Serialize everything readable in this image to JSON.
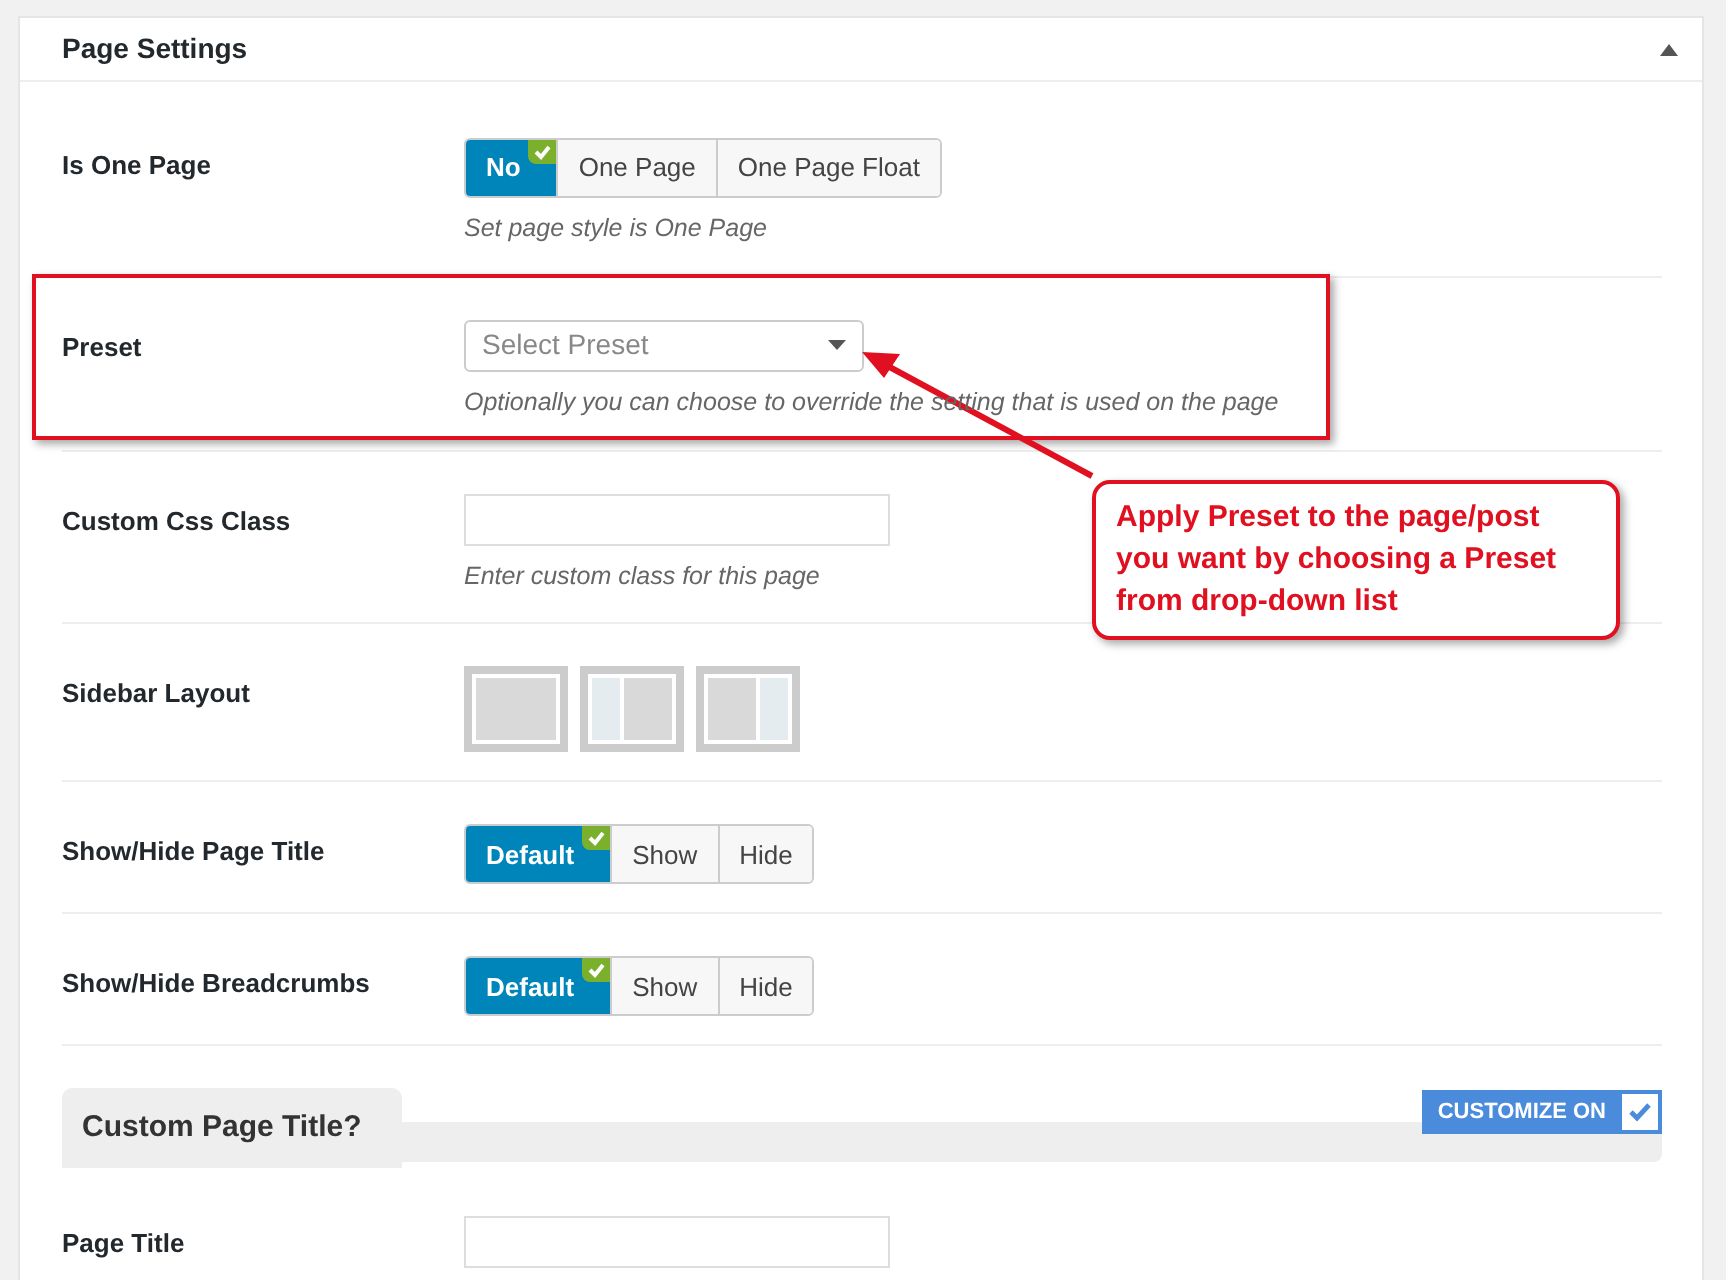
{
  "panel": {
    "title": "Page Settings",
    "expanded": true
  },
  "fields": [
    {
      "kind": "segmented",
      "label": "Is One Page",
      "options": [
        {
          "label": "No",
          "selected": true
        },
        {
          "label": "One Page",
          "selected": false
        },
        {
          "label": "One Page Float",
          "selected": false
        }
      ],
      "description": "Set page style is One Page"
    },
    {
      "kind": "select",
      "label": "Preset",
      "placeholder": "Select Preset",
      "description": "Optionally you can choose to override the setting that is used on the page"
    },
    {
      "kind": "text",
      "label": "Custom Css Class",
      "description": "Enter custom class for this page"
    },
    {
      "kind": "layout",
      "label": "Sidebar Layout",
      "options": [
        {
          "kind": "full"
        },
        {
          "kind": "left"
        },
        {
          "kind": "right"
        }
      ]
    },
    {
      "kind": "segmented",
      "label": "Show/Hide Page Title",
      "options": [
        {
          "label": "Default",
          "selected": true
        },
        {
          "label": "Show",
          "selected": false
        },
        {
          "label": "Hide",
          "selected": false
        }
      ]
    },
    {
      "kind": "segmented",
      "label": "Show/Hide Breadcrumbs",
      "options": [
        {
          "label": "Default",
          "selected": true
        },
        {
          "label": "Show",
          "selected": false
        },
        {
          "label": "Hide",
          "selected": false
        }
      ]
    }
  ],
  "section": {
    "title": "Custom Page Title?",
    "toggle": {
      "label": "CUSTOMIZE ON",
      "checked": true
    }
  },
  "section_fields": [
    {
      "kind": "text",
      "label": "Page Title"
    }
  ],
  "annotation": {
    "lines": [
      "Apply Preset to the page/post",
      "you want by choosing a Preset",
      "from drop-down list"
    ]
  }
}
